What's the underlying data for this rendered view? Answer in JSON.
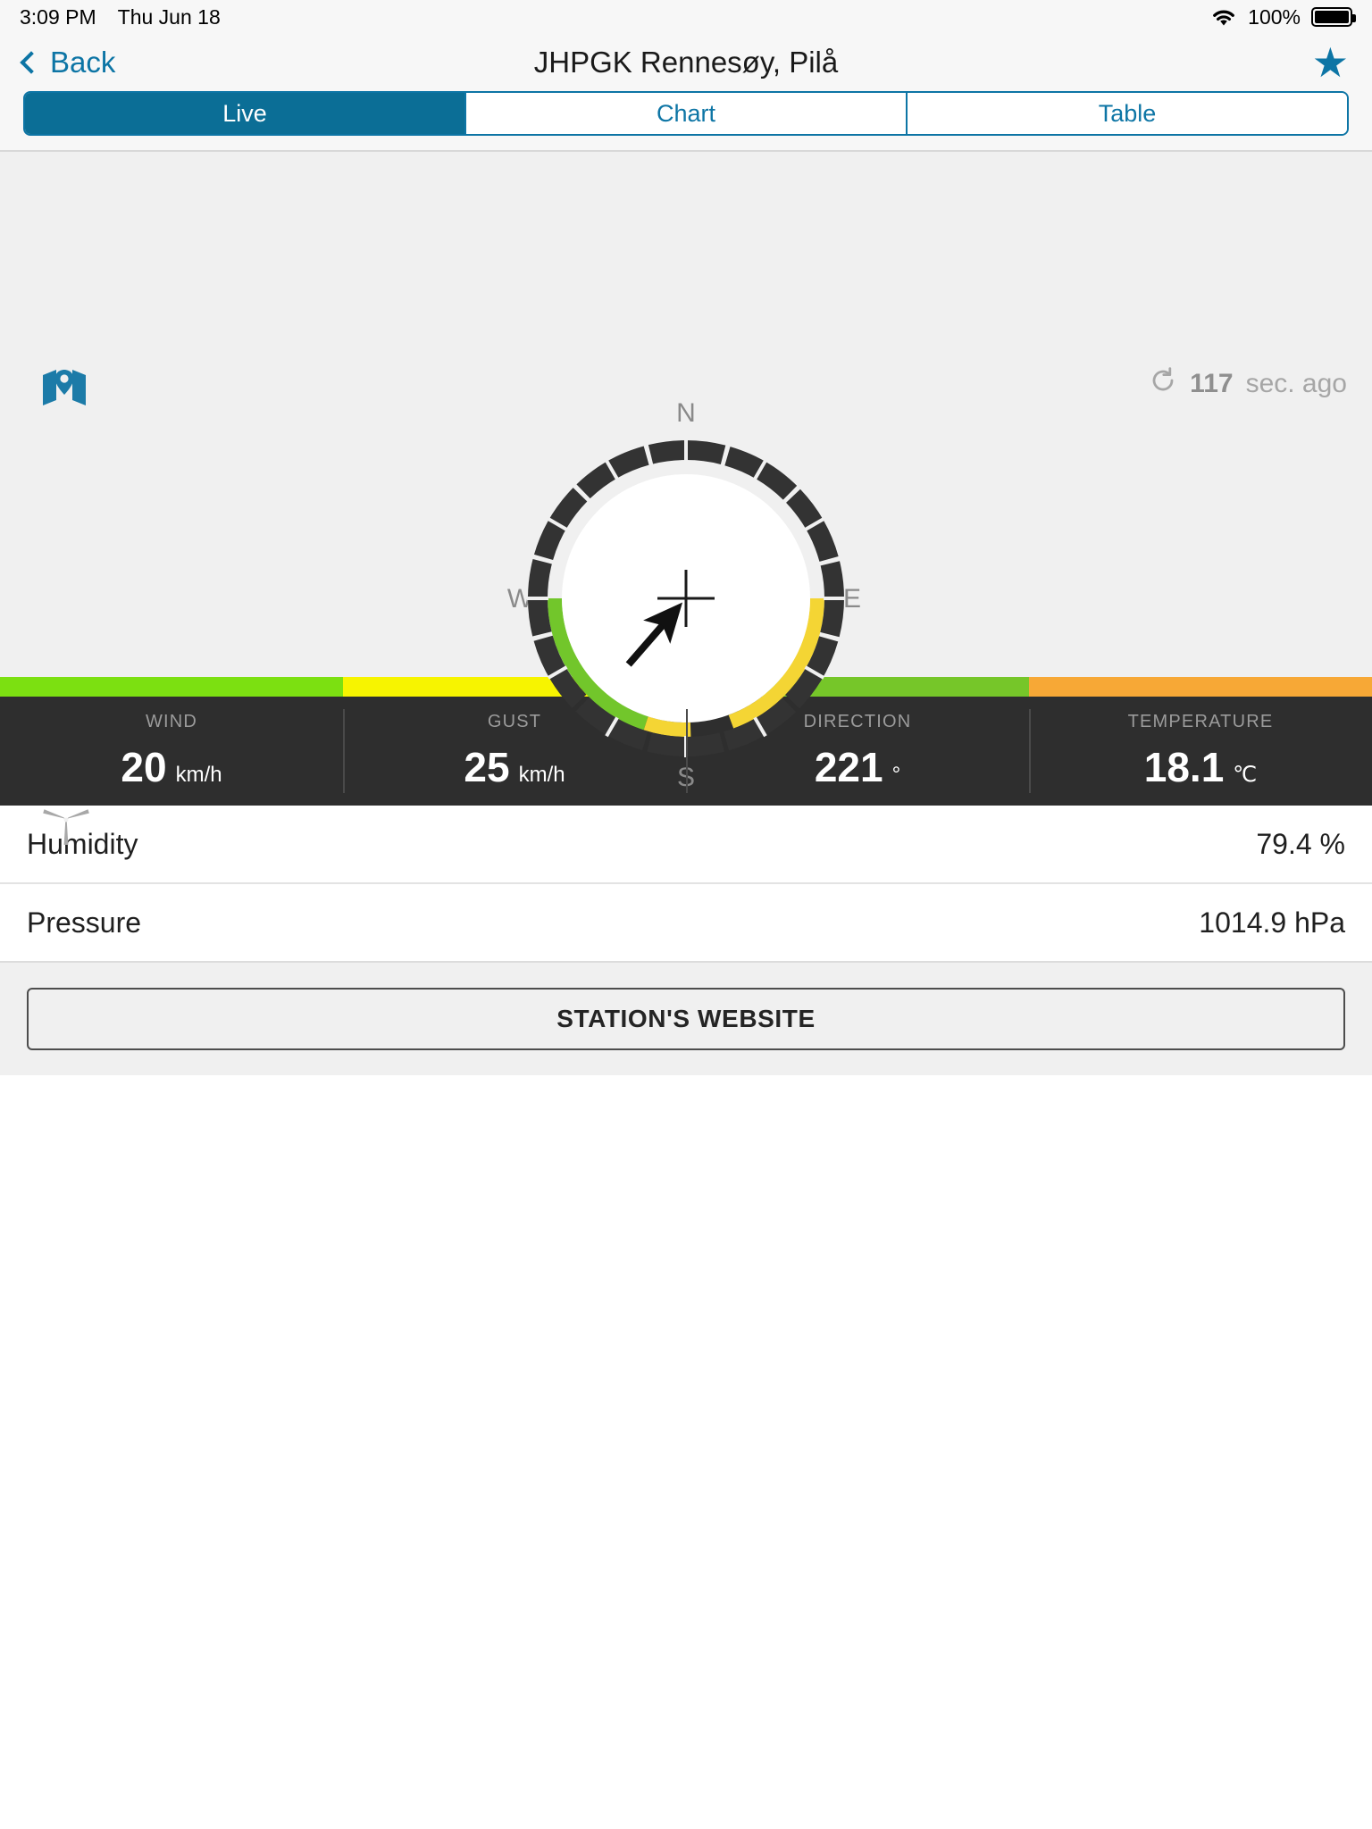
{
  "status_bar": {
    "time": "3:09 PM",
    "date": "Thu Jun 18",
    "battery_percent": "100%",
    "wifi_icon": "wifi-icon",
    "battery_icon": "battery-icon"
  },
  "nav": {
    "back_label": "Back",
    "title": "JHPGK Rennesøy, Pilå",
    "favorite_icon": "star-icon",
    "accent_color": "#0d75a5"
  },
  "tabs": [
    {
      "label": "Live",
      "active": true
    },
    {
      "label": "Chart",
      "active": false
    },
    {
      "label": "Table",
      "active": false
    }
  ],
  "live": {
    "map_icon": "map-pin-icon",
    "turbine_icon": "wind-turbine-icon",
    "refresh_icon": "refresh-icon",
    "refresh_value": "117",
    "refresh_suffix": "sec. ago",
    "compass": {
      "label_n": "N",
      "label_e": "E",
      "label_s": "S",
      "label_w": "W",
      "wind_direction_deg": 221,
      "arrow_points_to_deg": 41,
      "ring_color": "#333333",
      "arc_segments": [
        {
          "from_deg": 160,
          "to_deg": 180,
          "color": "#F4D534"
        },
        {
          "from_deg": 180,
          "to_deg": 252,
          "color": "#72C62B"
        },
        {
          "from_deg": 252,
          "to_deg": 272,
          "color": "#F4D534"
        }
      ]
    }
  },
  "metrics": [
    {
      "label": "WIND",
      "value": "20",
      "unit": "km/h",
      "color": "#7CE011"
    },
    {
      "label": "GUST",
      "value": "25",
      "unit": "km/h",
      "color": "#F7F400"
    },
    {
      "label": "DIRECTION",
      "value": "221",
      "unit": "°",
      "color": "#76C629"
    },
    {
      "label": "TEMPERATURE",
      "value": "18.1",
      "unit": "℃",
      "color": "#F7A836"
    }
  ],
  "detail_rows": [
    {
      "label": "Humidity",
      "value": "79.4 %"
    },
    {
      "label": "Pressure",
      "value": "1014.9 hPa"
    }
  ],
  "website_button": {
    "label": "STATION'S WEBSITE"
  }
}
